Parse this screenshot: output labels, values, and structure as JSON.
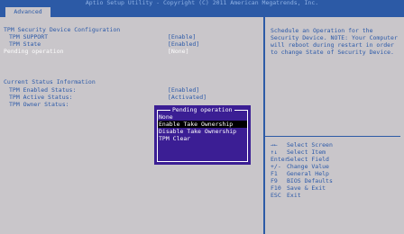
{
  "header": {
    "title": "Aptio Setup Utility - Copyright (C) 2011 American Megatrends, Inc.",
    "active_tab": "Advanced"
  },
  "main": {
    "section_title": "TPM Security Device Configuration",
    "rows": [
      {
        "label": "TPM SUPPORT",
        "value": "[Enable]"
      },
      {
        "label": "TPM State",
        "value": "[Enabled]"
      },
      {
        "label": "Pending operation",
        "value": "[None]"
      }
    ],
    "status_title": "Current Status Information",
    "status_rows": [
      {
        "label": "TPM Enabled Status:",
        "value": "[Enabled]"
      },
      {
        "label": "TPM Active Status:",
        "value": "[Activated]"
      },
      {
        "label": "TPM Owner Status:",
        "value": ""
      }
    ]
  },
  "popup": {
    "title": "Pending operation",
    "options": [
      "None",
      "Enable Take Ownership",
      "Disable Take Ownership",
      "TPM Clear"
    ],
    "selected": "Enable Take Ownership"
  },
  "help_text": "Schedule an Operation for the Security Device. NOTE: Your Computer will reboot during restart in order to change State of Security Device.",
  "keys": [
    {
      "key": "→←",
      "desc": "Select Screen"
    },
    {
      "key": "↑↓",
      "desc": "Select Item"
    },
    {
      "key": "Enter",
      "desc": "Select Field"
    },
    {
      "key": "+/-",
      "desc": "Change Value"
    },
    {
      "key": "F1",
      "desc": "General Help"
    },
    {
      "key": "F9",
      "desc": "BIOS Defaults"
    },
    {
      "key": "F10",
      "desc": "Save & Exit"
    },
    {
      "key": "ESC",
      "desc": "Exit"
    }
  ],
  "colors": {
    "accent_blue": "#2c5aa6",
    "text_blue": "#2b59a8",
    "background_gray": "#c9c6ca",
    "popup_purple": "#3b1e94",
    "highlight": "#ffffff"
  }
}
